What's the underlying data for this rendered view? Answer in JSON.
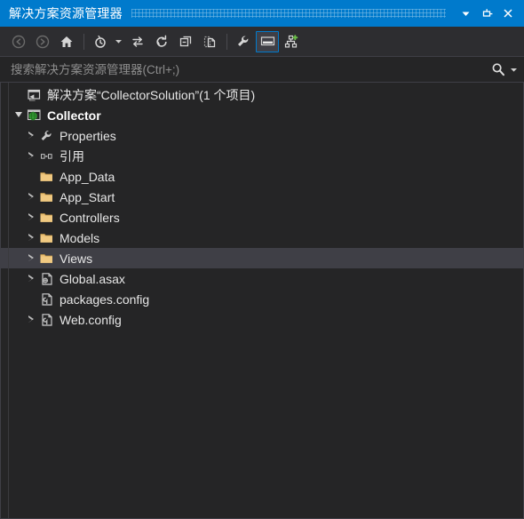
{
  "window": {
    "title": "解决方案资源管理器",
    "accent_color": "#007acc",
    "background_color": "#252526",
    "toolbar_color": "#2d2d30",
    "selection_color": "#3f3f46",
    "controls": [
      {
        "name": "window-menu-dropdown",
        "glyph": "▼",
        "label": "窗口菜单"
      },
      {
        "name": "auto-hide-pin",
        "glyph": "pin",
        "label": "自动隐藏"
      },
      {
        "name": "close-window",
        "glyph": "✕",
        "label": "关闭"
      }
    ]
  },
  "toolbar": {
    "buttons": [
      {
        "name": "back-button",
        "icon": "back-arrow-icon",
        "label": "后退",
        "disabled": true,
        "active": false
      },
      {
        "name": "forward-button",
        "icon": "forward-arrow-icon",
        "label": "前进",
        "disabled": true,
        "active": false
      },
      {
        "name": "home-button",
        "icon": "home-icon",
        "label": "主页",
        "disabled": false,
        "active": false
      },
      {
        "name": "pending-changes-button",
        "icon": "pending-changes-clock-icon",
        "label": "挂起的更改筛选器",
        "disabled": false,
        "active": false
      },
      {
        "name": "sync-with-active-document-button",
        "icon": "sync-arrows-icon",
        "label": "与活动文档同步",
        "disabled": false,
        "active": false
      },
      {
        "name": "refresh-button",
        "icon": "refresh-icon",
        "label": "刷新",
        "disabled": false,
        "active": false
      },
      {
        "name": "collapse-all-button",
        "icon": "collapse-all-icon",
        "label": "全部折叠",
        "disabled": false,
        "active": false
      },
      {
        "name": "show-all-files-button",
        "icon": "show-all-files-icon",
        "label": "显示所有文件",
        "disabled": false,
        "active": false
      },
      {
        "name": "properties-button",
        "icon": "wrench-icon",
        "label": "属性",
        "disabled": false,
        "active": false
      },
      {
        "name": "preview-selected-items-button",
        "icon": "preview-pane-icon",
        "label": "预览选定项",
        "disabled": false,
        "active": true
      },
      {
        "name": "view-code-map-button",
        "icon": "code-map-icon",
        "label": "查看代码图",
        "disabled": false,
        "active": false
      }
    ]
  },
  "search": {
    "placeholder": "搜索解决方案资源管理器(Ctrl+;)",
    "value": "",
    "icon": "search-icon",
    "dropdown_glyph": "▾"
  },
  "tree": {
    "items": [
      {
        "name": "solution-node",
        "label": "解决方案“CollectorSolution”(1 个项目)",
        "icon": "solution-icon",
        "indent": 0,
        "expander": "none",
        "bold": false,
        "selected": false
      },
      {
        "name": "project-collector",
        "label": "Collector",
        "icon": "web-project-icon",
        "indent": 0,
        "expander": "expanded",
        "bold": true,
        "selected": false
      },
      {
        "name": "node-properties",
        "label": "Properties",
        "icon": "wrench-icon",
        "indent": 1,
        "expander": "collapsed",
        "bold": false,
        "selected": false
      },
      {
        "name": "node-references",
        "label": "引用",
        "icon": "references-icon",
        "indent": 1,
        "expander": "collapsed",
        "bold": false,
        "selected": false
      },
      {
        "name": "folder-app-data",
        "label": "App_Data",
        "icon": "folder-icon",
        "indent": 1,
        "expander": "none",
        "bold": false,
        "selected": false
      },
      {
        "name": "folder-app-start",
        "label": "App_Start",
        "icon": "folder-icon",
        "indent": 1,
        "expander": "collapsed",
        "bold": false,
        "selected": false
      },
      {
        "name": "folder-controllers",
        "label": "Controllers",
        "icon": "folder-icon",
        "indent": 1,
        "expander": "collapsed",
        "bold": false,
        "selected": false
      },
      {
        "name": "folder-models",
        "label": "Models",
        "icon": "folder-icon",
        "indent": 1,
        "expander": "collapsed",
        "bold": false,
        "selected": false
      },
      {
        "name": "folder-views",
        "label": "Views",
        "icon": "folder-icon",
        "indent": 1,
        "expander": "collapsed",
        "bold": false,
        "selected": true
      },
      {
        "name": "file-global-asax",
        "label": "Global.asax",
        "icon": "asax-file-icon",
        "indent": 1,
        "expander": "collapsed",
        "bold": false,
        "selected": false
      },
      {
        "name": "file-packages-config",
        "label": "packages.config",
        "icon": "config-file-icon",
        "indent": 1,
        "expander": "none",
        "bold": false,
        "selected": false
      },
      {
        "name": "file-web-config",
        "label": "Web.config",
        "icon": "config-file-icon",
        "indent": 1,
        "expander": "collapsed",
        "bold": false,
        "selected": false
      }
    ]
  }
}
